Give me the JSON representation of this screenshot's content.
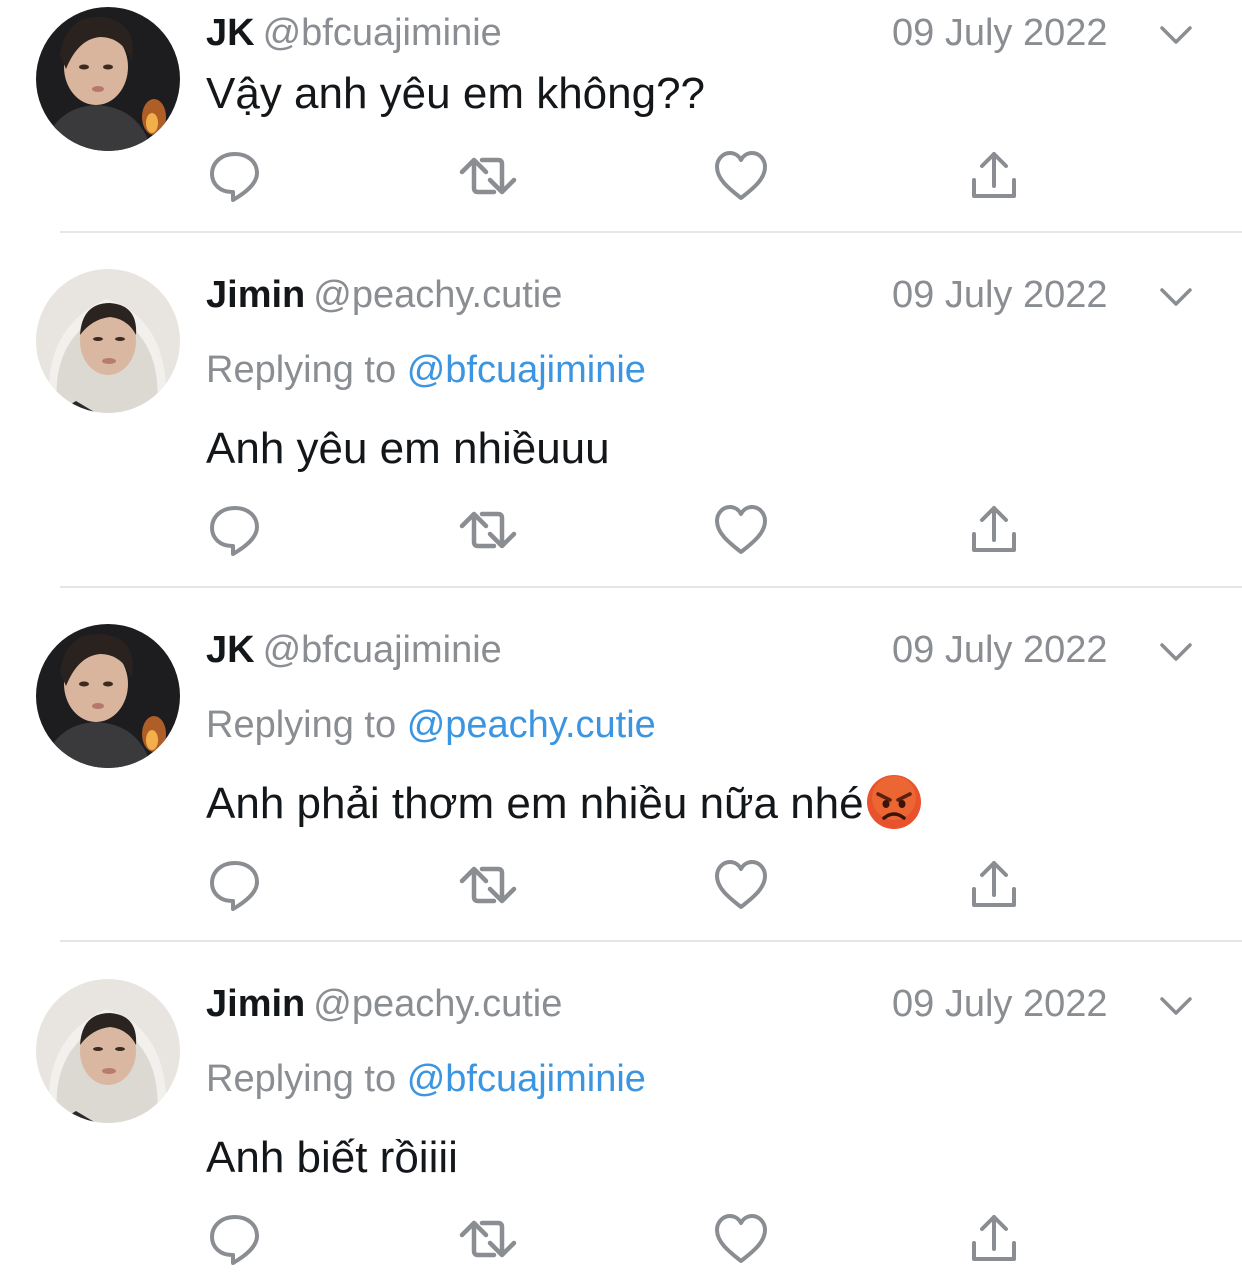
{
  "tweets": [
    {
      "name": "JK",
      "handle": "@bfcuajiminie",
      "date": "09 July 2022",
      "replying_label": "",
      "replying_to": "",
      "text": "Vậy anh yêu em không??",
      "avatar": "jk-avatar"
    },
    {
      "name": "Jimin",
      "handle": "@peachy.cutie",
      "date": "09 July 2022",
      "replying_label": "Replying to",
      "replying_to": "@bfcuajiminie",
      "text": "Anh yêu em nhiềuuu",
      "avatar": "jimin-avatar"
    },
    {
      "name": "JK",
      "handle": "@bfcuajiminie",
      "date": "09 July 2022",
      "replying_label": "Replying to",
      "replying_to": "@peachy.cutie",
      "text": "Anh phải thơm em nhiều nữa nhé",
      "emoji": "angry-face-emoji",
      "avatar": "jk-avatar"
    },
    {
      "name": "Jimin",
      "handle": "@peachy.cutie",
      "date": "09 July 2022",
      "replying_label": "Replying to",
      "replying_to": "@bfcuajiminie",
      "text": "Anh biết rồiiii",
      "avatar": "jimin-avatar"
    }
  ],
  "icons": {
    "reply": "reply-icon",
    "retweet": "retweet-icon",
    "like": "heart-icon",
    "share": "share-icon",
    "menu": "chevron-down-icon"
  },
  "colors": {
    "text": "#14171a",
    "muted": "#8a8d91",
    "link": "#3c95e0",
    "divider": "#e4e6e8"
  }
}
